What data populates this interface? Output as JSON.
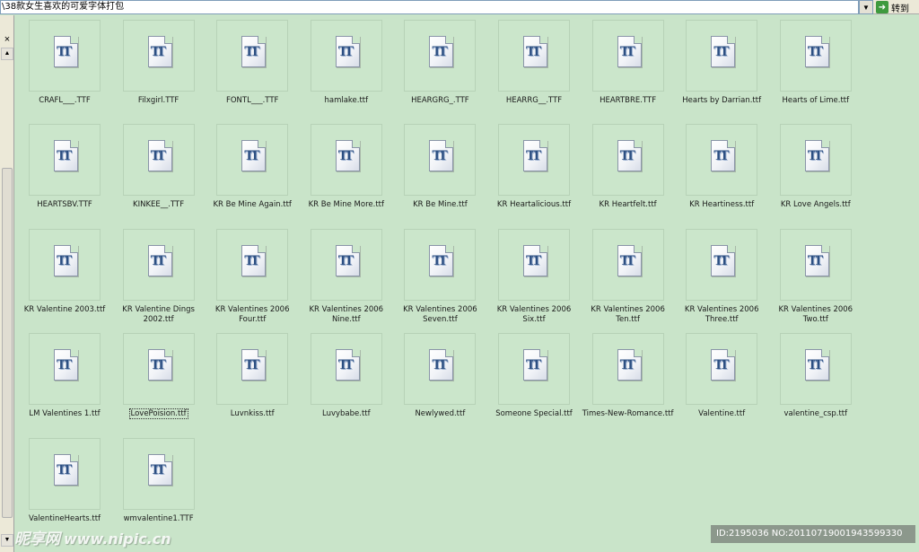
{
  "address": {
    "path": "\\38款女生喜欢的可爱字体打包",
    "dropdown_icon": "▼",
    "go_label": "转到",
    "go_icon": "➜"
  },
  "left_panel": {
    "close_icon": "×",
    "scroll_up_icon": "▲",
    "scroll_down_icon": "▼"
  },
  "file_icon_label": "TT",
  "files": [
    {
      "name": "CRAFL___.TTF"
    },
    {
      "name": "Filxgirl.TTF"
    },
    {
      "name": "FONTL___.TTF"
    },
    {
      "name": "hamlake.ttf"
    },
    {
      "name": "HEARGRG_.TTF"
    },
    {
      "name": "HEARRG__.TTF"
    },
    {
      "name": "HEARTBRE.TTF"
    },
    {
      "name": "Hearts by Darrian.ttf"
    },
    {
      "name": "Hearts of Lime.ttf"
    },
    {
      "name": "HEARTSBV.TTF"
    },
    {
      "name": "KINKEE__.TTF"
    },
    {
      "name": "KR Be Mine Again.ttf"
    },
    {
      "name": "KR Be Mine More.ttf"
    },
    {
      "name": "KR Be Mine.ttf"
    },
    {
      "name": "KR Heartalicious.ttf"
    },
    {
      "name": "KR Heartfelt.ttf"
    },
    {
      "name": "KR Heartiness.ttf"
    },
    {
      "name": "KR Love Angels.ttf"
    },
    {
      "name": "KR Valentine 2003.ttf"
    },
    {
      "name": "KR Valentine Dings 2002.ttf"
    },
    {
      "name": "KR Valentines 2006 Four.ttf"
    },
    {
      "name": "KR Valentines 2006 Nine.ttf"
    },
    {
      "name": "KR Valentines 2006 Seven.ttf"
    },
    {
      "name": "KR Valentines 2006 Six.ttf"
    },
    {
      "name": "KR Valentines 2006 Ten.ttf"
    },
    {
      "name": "KR Valentines 2006 Three.ttf"
    },
    {
      "name": "KR Valentines 2006 Two.ttf"
    },
    {
      "name": "LM Valentines  1.ttf"
    },
    {
      "name": "LovePoision.ttf",
      "selected": true
    },
    {
      "name": "Luvnkiss.ttf"
    },
    {
      "name": "Luvybabe.ttf"
    },
    {
      "name": "Newlywed.ttf"
    },
    {
      "name": "Someone Special.ttf"
    },
    {
      "name": "Times-New-Romance.ttf"
    },
    {
      "name": "Valentine.ttf"
    },
    {
      "name": "valentine_csp.ttf"
    },
    {
      "name": "ValentineHearts.ttf"
    },
    {
      "name": "wmvalentine1.TTF"
    }
  ],
  "watermark": {
    "brand": "昵享网",
    "url": "www.nipic.cn",
    "id_text": "ID:2195036 NO:20110719001943599330"
  }
}
